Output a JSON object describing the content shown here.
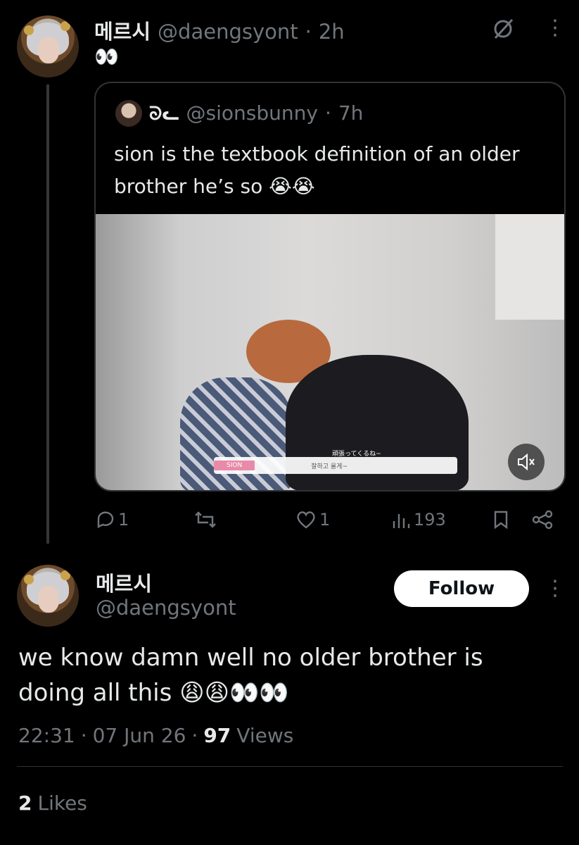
{
  "reply_tweet": {
    "display_name": "메르시",
    "handle": "@daengsyont",
    "separator": "·",
    "time": "2h",
    "body": "👀",
    "more": "⋮"
  },
  "quote": {
    "display_name": "ᘐᓚ",
    "handle": "@sionsbunny",
    "separator": "·",
    "time": "7h",
    "body_line1": "sion is the textbook definition of an older",
    "body_line2": "brother he’s so 😭😭",
    "video": {
      "subtitle_tag": "SION",
      "subtitle_jp": "頑張ってくるね~",
      "subtitle_kr": "잘하고 올게~"
    }
  },
  "actions": {
    "replies": "1",
    "reposts": "",
    "likes": "1",
    "views": "193"
  },
  "main_tweet": {
    "display_name": "메르시",
    "handle": "@daengsyont",
    "follow_label": "Follow",
    "more": "⋮",
    "body_line1": "we know damn well no older brother is",
    "body_line2": "doing all this 😩😩👀👀",
    "time": "22:31",
    "date": "07 Jun 26",
    "sep1": "·",
    "sep2": "·",
    "views_count": "97",
    "views_label": "Views"
  },
  "likes": {
    "count": "2",
    "label": "Likes"
  }
}
